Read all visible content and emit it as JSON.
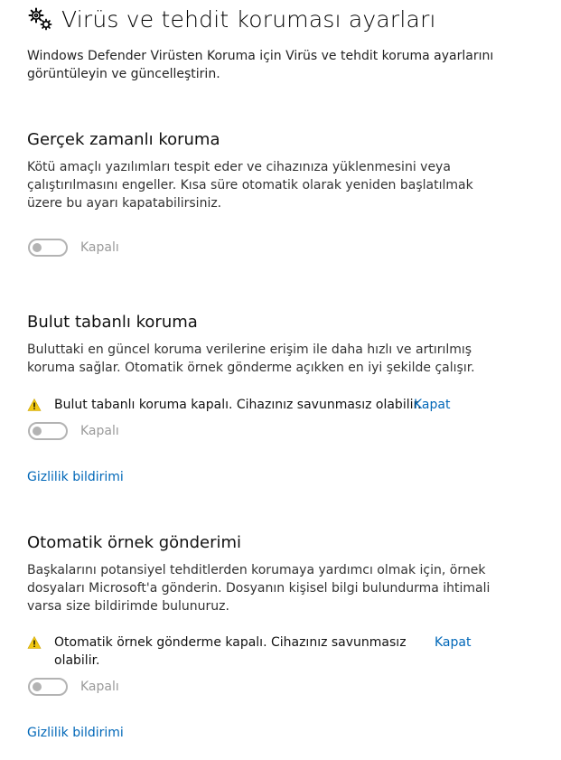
{
  "page": {
    "title": "Virüs ve tehdit koruması ayarları",
    "description_line1": "Windows Defender Virüsten Koruma için Virüs ve tehdit koruma ayarlarını",
    "description_line2": "görüntüleyin ve güncelleştirin."
  },
  "sections": [
    {
      "title": "Gerçek zamanlı koruma",
      "description_lines": [
        "Kötü amaçlı yazılımları tespit eder ve cihazınıza yüklenmesini veya",
        "çalıştırılmasını engeller. Kısa süre otomatik olarak yeniden başlatılmak",
        "üzere bu ayarı kapatabilirsiniz."
      ],
      "toggle_label": "Kapalı",
      "toggle_on": false
    },
    {
      "title": "Bulut tabanlı koruma",
      "description_lines": [
        "Buluttaki en güncel koruma verilerine erişim ile daha hızlı ve artırılmış",
        "koruma sağlar. Otomatik örnek gönderme açıkken en iyi şekilde çalışır."
      ],
      "warning_text": "Bulut tabanlı koruma kapalı. Cihazınız savunmasız olabilir.",
      "warning_action": "Kapat",
      "toggle_label": "Kapalı",
      "toggle_on": false,
      "privacy_link": "Gizlilik bildirimi"
    },
    {
      "title": "Otomatik örnek gönderimi",
      "description_lines": [
        "Başkalarını potansiyel tehditlerden korumaya yardımcı olmak için, örnek",
        "dosyaları Microsoft'a gönderin.  Dosyanın kişisel bilgi bulundurma ihtimali",
        "varsa size bildirimde bulunuruz."
      ],
      "warning_lines": [
        "Otomatik örnek gönderme kapalı. Cihazınız savunmasız",
        "olabilir."
      ],
      "warning_action": "Kapat",
      "toggle_label": "Kapalı",
      "toggle_on": false,
      "privacy_link": "Gizlilik bildirimi"
    }
  ],
  "colors": {
    "link": "#0067b8",
    "toggle_off": "#b3b3b3",
    "warning": "#f2c811"
  },
  "icons": {
    "header": "gears-icon",
    "warning": "warning-icon"
  }
}
